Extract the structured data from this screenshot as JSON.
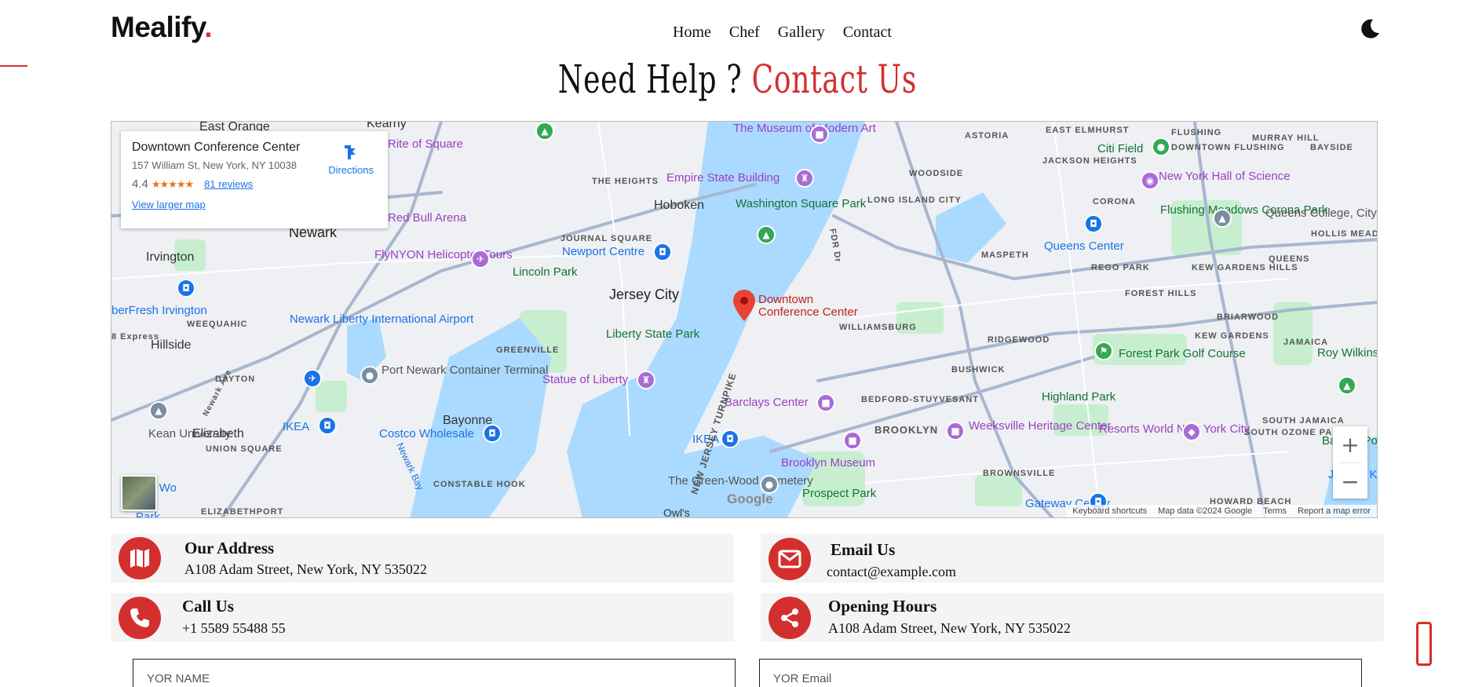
{
  "header": {
    "brand": "Mealify",
    "brand_dot": ".",
    "nav": [
      "Home",
      "Chef",
      "Gallery",
      "Contact"
    ],
    "theme_icon": "moon-icon"
  },
  "title": {
    "part1": "Need Help ?",
    "part2": "Contact Us"
  },
  "colors": {
    "accent": "#d32f2f",
    "card_bg": "#f4f4f4",
    "map_water": "#aadaff",
    "map_park": "#c7efcf"
  },
  "map": {
    "place_name": "Downtown Conference Center",
    "address": "157 William St, New York, NY 10038",
    "rating": "4.4",
    "stars": "★★★★★",
    "reviews": "81 reviews",
    "directions": "Directions",
    "view_larger": "View larger map",
    "google": "Google",
    "zoom_in": "+",
    "zoom_out": "−",
    "attribution": [
      "Keyboard shortcuts",
      "Map data ©2024 Google",
      "Terms",
      "Report a map error"
    ],
    "labels": {
      "newark": "Newark",
      "jersey_city": "Jersey City",
      "hoboken": "Hoboken",
      "irvington": "Irvington",
      "hillside": "Hillside",
      "elizabeth": "Elizabeth",
      "bayonne": "Bayonne",
      "east_orange": "East Orange",
      "kearny": "Kearny",
      "the_heights": "THE HEIGHTS",
      "journal_square": "JOURNAL SQUARE",
      "greenville": "GREENVILLE",
      "dayton": "DAYTON",
      "weequahic": "WEEQUAHIC",
      "union_square": "UNION SQUARE",
      "elizabethport": "ELIZABETHPORT",
      "constable_hook": "CONSTABLE HOOK",
      "astoria": "ASTORIA",
      "east_elmhurst": "EAST ELMHURST",
      "flushing": "FLUSHING",
      "murray_hill": "MURRAY HILL",
      "bayside": "BAYSIDE",
      "woodside": "WOODSIDE",
      "jackson_heights": "JACKSON HEIGHTS",
      "downtown_flushing": "DOWNTOWN FLUSHING",
      "long_island_city": "LONG ISLAND CITY",
      "corona": "CORONA",
      "maspeth": "MASPETH",
      "rego_park": "REGO PARK",
      "kew_gardens_hills": "KEW GARDENS HILLS",
      "queens": "QUEENS",
      "forest_hills": "FOREST HILLS",
      "briarwood": "BRIARWOOD",
      "jamaica": "JAMAICA",
      "kew_gardens": "KEW GARDENS",
      "ridgewood": "RIDGEWOOD",
      "williamsburg": "WILLIAMSBURG",
      "bushwick": "BUSHWICK",
      "bed_stuy": "BEDFORD-STUYVESANT",
      "brooklyn": "BROOKLYN",
      "brownsville": "BROWNSVILLE",
      "south_jamaica": "SOUTH JAMAICA",
      "south_ozone_park": "SOUTH OZONE PARK",
      "howard_beach": "HOWARD BEACH",
      "hollis_meadows": "HOLLIS MEADOWS",
      "museum_modern_art": "The Museum of Modern Art",
      "empire_state": "Empire State Building",
      "washington_square": "Washington Square Park",
      "newport_centre": "Newport Centre",
      "lincoln_park": "Lincoln Park",
      "flynyon": "FlyNYON Helicopter Tours",
      "red_bull": "Red Bull Arena",
      "rite_of_square": "Rite of Square",
      "newark_airport": "Newark Liberty International Airport",
      "port_newark": "Port Newark Container Terminal",
      "liberty_park": "Liberty State Park",
      "statue_liberty": "Statue of Liberty",
      "barclays": "Barclays Center",
      "costco": "Costco Wholesale",
      "ikea_newark": "IKEA",
      "ikea_brooklyn": "IKEA",
      "kean": "Kean University",
      "shoprite": "berFresh Irvington",
      "green_wood": "The Green-Wood Cemetery",
      "brooklyn_museum": "Brooklyn Museum",
      "prospect_park": "Prospect Park",
      "weeksville": "Weeksville Heritage Center",
      "highland_park": "Highland Park",
      "resorts_world": "Resorts World New York City",
      "forest_park_golf": "Forest Park Golf Course",
      "roy_wilkins": "Roy Wilkins Park",
      "bayside_pond": "Baisley Pond Park",
      "gateway": "Gateway Center",
      "queens_center": "Queens Center",
      "flushing_meadows": "Flushing Meadows Corona Park",
      "queens_college": "Queens College, City University of New York",
      "ny_hall_science": "New York Hall of Science",
      "citi_field": "Citi Field",
      "jfk": "John F. Kennedy International",
      "downtown_conf": "Downtown Conference Center",
      "nj_turnpike": "NEW JERSEY TURNPIKE",
      "owls_head": "Owl's",
      "fdr": "FDR Dr",
      "newark_bay": "Newark Bay",
      "newark_ave": "Newark Ave",
      "express": "8 Express",
      "park_sw": "Park",
      "th_wo": "th Wo"
    }
  },
  "contacts": {
    "address": {
      "title": "Our Address",
      "text": "A108 Adam Street, New York, NY 535022",
      "icon": "map-icon"
    },
    "email": {
      "title": "Email Us",
      "text": "contact@example.com",
      "icon": "envelope-icon"
    },
    "call": {
      "title": "Call Us",
      "text": "+1 5589 55488 55",
      "icon": "phone-icon"
    },
    "hours": {
      "title": "Opening Hours",
      "text": "A108 Adam Street, New York, NY 535022",
      "icon": "share-icon"
    }
  },
  "form": {
    "name_placeholder": "YOR NAME",
    "email_placeholder": "YOR Email"
  }
}
